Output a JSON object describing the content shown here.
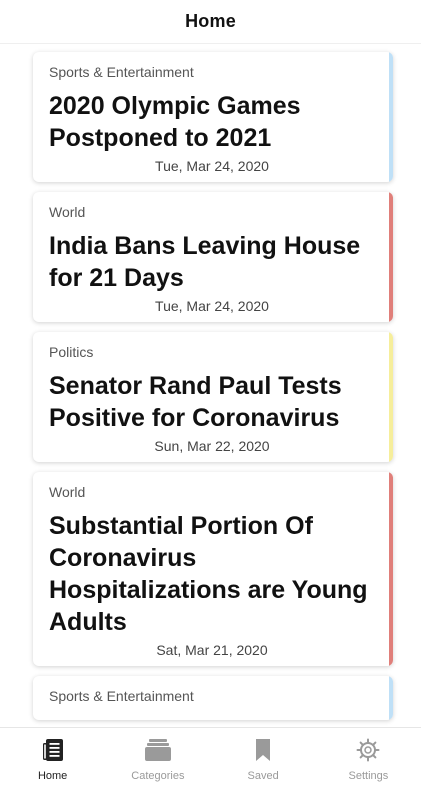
{
  "header": {
    "title": "Home"
  },
  "articles": [
    {
      "category": "Sports & Entertainment",
      "title": "2020 Olympic Games Postponed to 2021",
      "date": "Tue, Mar 24, 2020",
      "accent": "#bfe0f7"
    },
    {
      "category": "World",
      "title": "India Bans Leaving House for 21 Days",
      "date": "Tue, Mar 24, 2020",
      "accent": "#e07f7a"
    },
    {
      "category": "Politics",
      "title": "Senator Rand Paul Tests Positive for Coronavirus",
      "date": "Sun, Mar 22, 2020",
      "accent": "#f6ee9b"
    },
    {
      "category": "World",
      "title": "Substantial Portion Of Coronavirus Hospitalizations are Young Adults",
      "date": "Sat, Mar 21, 2020",
      "accent": "#e07f7a"
    },
    {
      "category": "Sports & Entertainment",
      "title": "",
      "date": "",
      "accent": "#bfe0f7"
    }
  ],
  "tabs": [
    {
      "label": "Home",
      "icon": "newspaper-icon",
      "active": true
    },
    {
      "label": "Categories",
      "icon": "folder-stack-icon",
      "active": false
    },
    {
      "label": "Saved",
      "icon": "bookmark-icon",
      "active": false
    },
    {
      "label": "Settings",
      "icon": "gear-icon",
      "active": false
    }
  ],
  "colors": {
    "active_tab": "#222222",
    "inactive_tab": "#9a9a9a"
  }
}
